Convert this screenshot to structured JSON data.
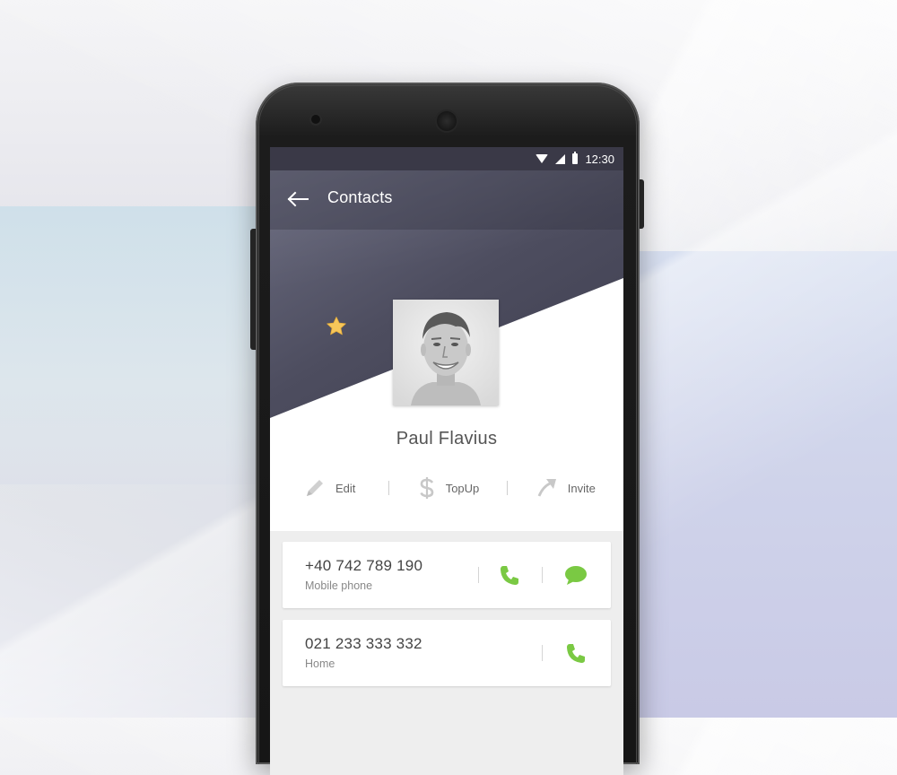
{
  "status_bar": {
    "time": "12:30",
    "icons": [
      "wifi-icon",
      "signal-icon",
      "battery-icon"
    ]
  },
  "app_bar": {
    "title": "Contacts",
    "back_icon": "arrow-left-icon"
  },
  "contact": {
    "name": "Paul Flavius",
    "favorite": true
  },
  "actions": [
    {
      "label": "Edit",
      "icon": "pencil-icon"
    },
    {
      "label": "TopUp",
      "icon": "dollar-icon"
    },
    {
      "label": "Invite",
      "icon": "arrow-up-right-icon"
    }
  ],
  "phones": [
    {
      "number": "+40 742 789 190",
      "type": "Mobile phone",
      "icons": [
        "phone-icon",
        "message-icon"
      ]
    },
    {
      "number": "021 233 333 332",
      "type": "Home",
      "icons": [
        "phone-icon"
      ]
    }
  ],
  "colors": {
    "header": "#4d4d5f",
    "statusbar": "#3a3947",
    "accent_green": "#7ac943",
    "star": "#f7c75a"
  }
}
